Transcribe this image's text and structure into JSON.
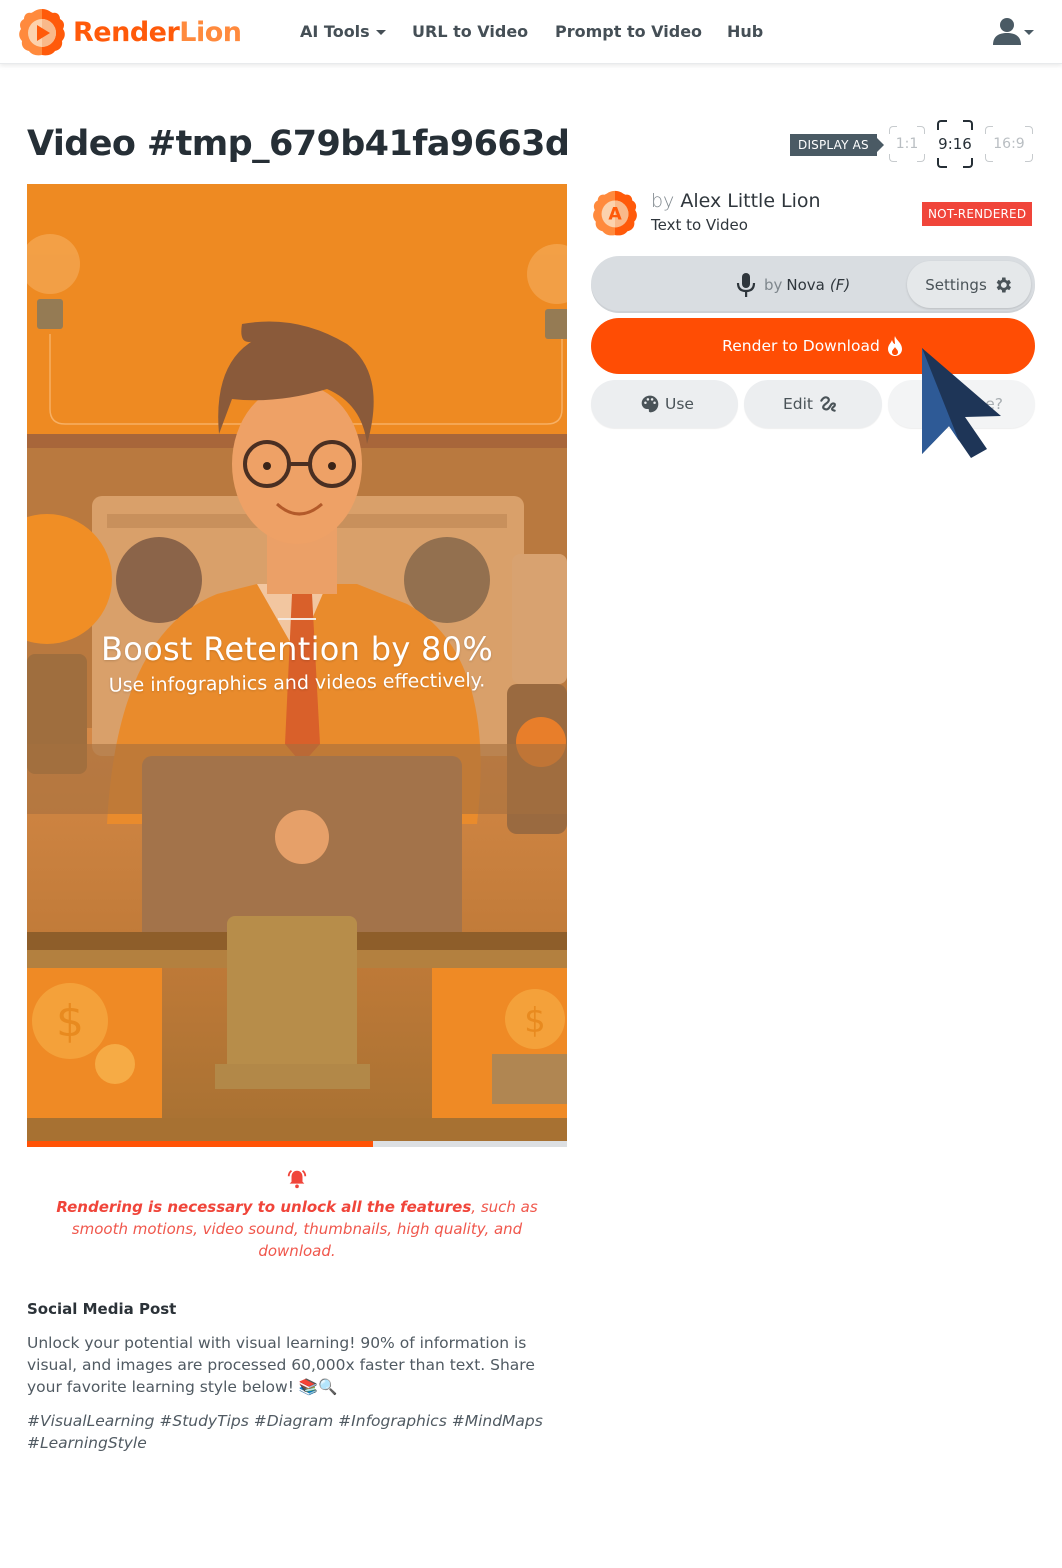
{
  "navbar": {
    "brand": {
      "part1": "Render",
      "part2": "Lion",
      "logo_icon": "lion-play-logo"
    },
    "items": [
      {
        "label": "AI Tools",
        "has_dropdown": true
      },
      {
        "label": "URL to Video",
        "has_dropdown": false
      },
      {
        "label": "Prompt to Video",
        "has_dropdown": false
      },
      {
        "label": "Hub",
        "has_dropdown": false
      }
    ],
    "user_menu_icon": "user-icon"
  },
  "page": {
    "title": "Video #tmp_679b41fa9663d"
  },
  "display_as": {
    "label": "DISPLAY AS",
    "options": [
      "1:1",
      "9:16",
      "16:9"
    ],
    "selected": "9:16"
  },
  "video": {
    "overlay_headline": "Boost Retention by 80%",
    "overlay_subtext": "Use infographics and videos effectively.",
    "progress_fraction": 0.64
  },
  "notice": {
    "icon": "bell-ringing-icon",
    "bold_text": "Rendering is necessary to unlock all the features",
    "rest_text": ", such as smooth motions, video sound, thumbnails, high quality, and download."
  },
  "social_post": {
    "heading": "Social Media Post",
    "body": "Unlock your potential with visual learning! 90% of information is visual, and images are processed 60,000x faster than text. Share your favorite learning style below! 📚🔍",
    "hashtags": "#VisualLearning #StudyTips #Diagram #Infographics #MindMaps #LearningStyle"
  },
  "author": {
    "by_label": "by",
    "name": "Alex Little Lion",
    "avatar_letter": "A",
    "type": "Text to Video",
    "status": "NOT-RENDERED"
  },
  "voice": {
    "icon": "microphone-icon",
    "by_label": "by",
    "name": "Nova",
    "gender": "(F)",
    "settings_label": "Settings",
    "settings_icon": "gear-icon"
  },
  "actions": {
    "render_label": "Render to Download",
    "render_icon": "fire-icon",
    "use_label": "Use",
    "use_icon": "palette-icon",
    "edit_label": "Edit",
    "edit_icon": "signature-icon",
    "third_label_visible": "e?"
  },
  "colors": {
    "brand_orange": "#ff4d04",
    "status_red": "#f0453a",
    "dark_text": "#262f36",
    "cursor_blue": "#2e5a96"
  }
}
